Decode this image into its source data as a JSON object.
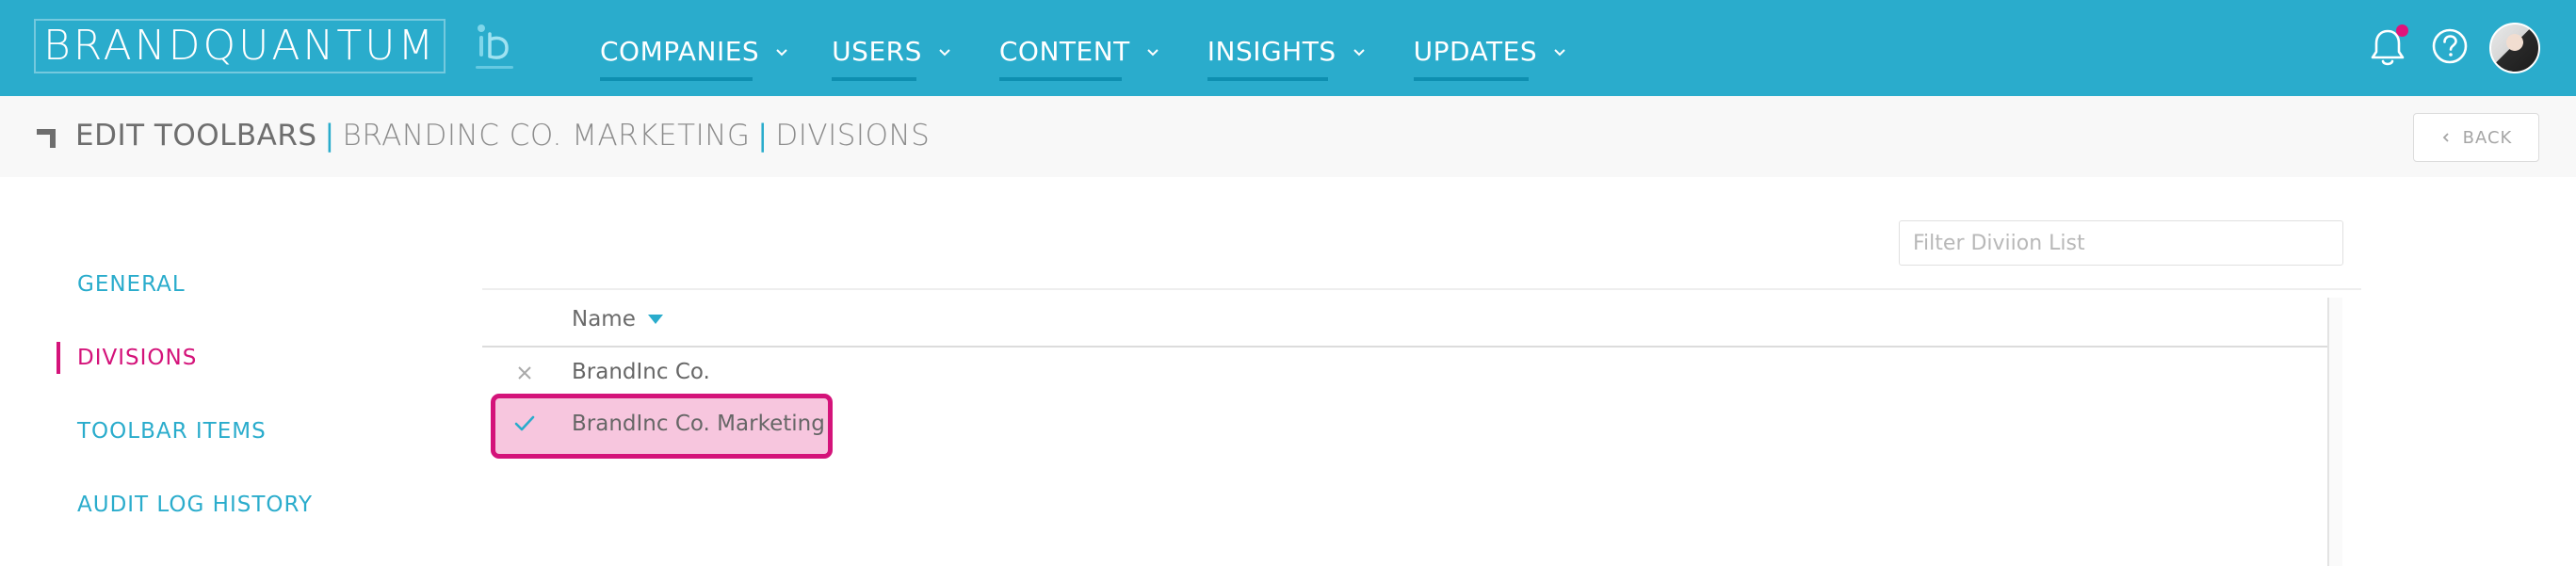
{
  "header": {
    "brand": "BRANDQUANTUM",
    "nav": [
      {
        "label": "COMPANIES"
      },
      {
        "label": "USERS"
      },
      {
        "label": "CONTENT"
      },
      {
        "label": "INSIGHTS"
      },
      {
        "label": "UPDATES"
      }
    ],
    "icons": {
      "notifications": "bell-icon",
      "help": "help-circle-icon",
      "dropdown": "chevron-down-icon"
    },
    "notification_dot_color": "#e0137a",
    "accent_color": "#2aaccc"
  },
  "breadcrumb": {
    "title": "EDIT TOOLBARS",
    "company": "BRANDINC CO. MARKETING",
    "section": "DIVISIONS",
    "separator": "|"
  },
  "back_button": {
    "label": "BACK"
  },
  "sidebar": {
    "items": [
      {
        "label": "GENERAL"
      },
      {
        "label": "DIVISIONS"
      },
      {
        "label": "TOOLBAR ITEMS"
      },
      {
        "label": "AUDIT LOG HISTORY"
      }
    ],
    "active_index": 1,
    "active_color": "#d4137a"
  },
  "filter": {
    "placeholder": "Filter Diviion List",
    "value": ""
  },
  "table": {
    "columns": [
      {
        "label": "Name",
        "sort": "descending"
      }
    ],
    "rows": [
      {
        "name": "BrandInc Co.",
        "selected": false,
        "icon": "x-icon"
      },
      {
        "name": "BrandInc Co. Marketing",
        "selected": true,
        "icon": "check-icon"
      }
    ]
  }
}
